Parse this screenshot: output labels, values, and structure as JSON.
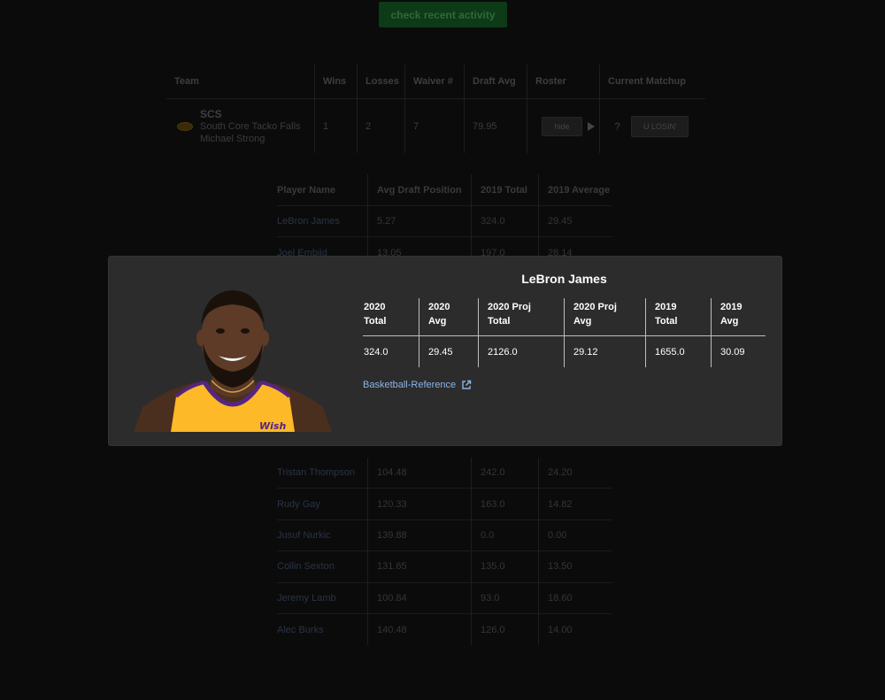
{
  "toolbar": {
    "activity_label": "check recent activity"
  },
  "team_table": {
    "headers": [
      "Team",
      "Wins",
      "Losses",
      "Waiver #",
      "Draft Avg",
      "Roster",
      "Current Matchup"
    ],
    "row": {
      "abbr": "SCS",
      "name": "South Core Tacko Falls",
      "owner": "Michael Strong",
      "wins": "1",
      "losses": "2",
      "waiver": "7",
      "draft_avg": "79.95",
      "hide_label": "hide",
      "matchup_label": "U LOSIN'",
      "matchup_icon": "?"
    }
  },
  "player_table": {
    "headers": [
      "Player Name",
      "Avg Draft Position",
      "2019 Total",
      "2019 Average"
    ],
    "rows_top": [
      [
        "LeBron James",
        "5.27",
        "324.0",
        "29.45"
      ],
      [
        "Joel Embiid",
        "13.05",
        "197.0",
        "28.14"
      ]
    ],
    "rows_bottom": [
      [
        "Tristan Thompson",
        "104.48",
        "242.0",
        "24.20"
      ],
      [
        "Rudy Gay",
        "120.33",
        "163.0",
        "14.82"
      ],
      [
        "Jusuf Nurkic",
        "139.88",
        "0.0",
        "0.00"
      ],
      [
        "Collin Sexton",
        "131.65",
        "135.0",
        "13.50"
      ],
      [
        "Jeremy Lamb",
        "100.84",
        "93.0",
        "18.60"
      ],
      [
        "Alec Burks",
        "140.48",
        "126.0",
        "14.00"
      ]
    ]
  },
  "modal": {
    "player_name": "LeBron James",
    "stat_headers": [
      [
        "2020",
        "Total"
      ],
      [
        "2020",
        "Avg"
      ],
      [
        "2020 Proj",
        "Total"
      ],
      [
        "2020 Proj",
        "Avg"
      ],
      [
        "2019",
        "Total"
      ],
      [
        "2019",
        "Avg"
      ]
    ],
    "stat_values": [
      "324.0",
      "29.45",
      "2126.0",
      "29.12",
      "1655.0",
      "30.09"
    ],
    "link_label": "Basketball-Reference",
    "jersey_text": "Wish"
  },
  "colors": {
    "background": "#0b0b0b",
    "modal_bg": "#2c2c2c",
    "link": "#8ab4e6",
    "jersey": "#fdb927",
    "activity_button": "#0d3a17"
  }
}
